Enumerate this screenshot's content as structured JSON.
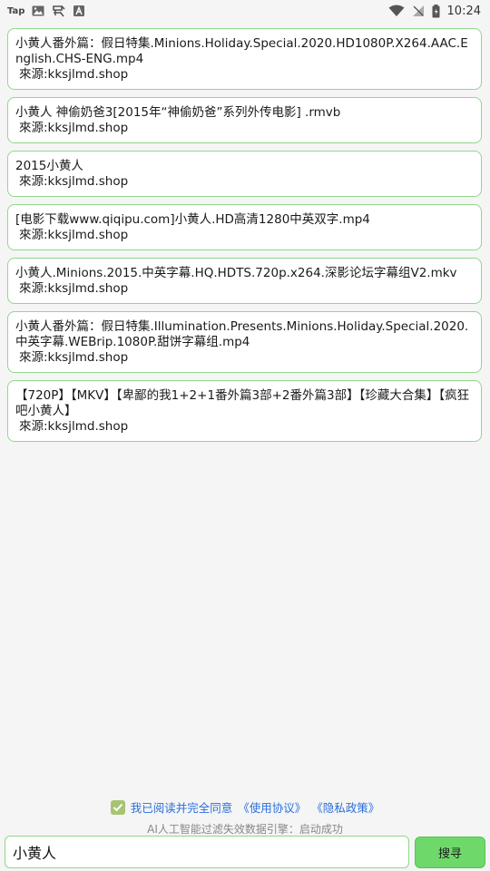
{
  "status_bar": {
    "left_icons": [
      "tap-icon",
      "image-icon",
      "kuaishou-icon",
      "font-icon"
    ],
    "tap_label": "Tap",
    "time": "10:24",
    "right_icons": [
      "wifi-icon",
      "no-signal-icon",
      "battery-icon"
    ]
  },
  "results": [
    {
      "title": "小黄人番外篇：假日特集.Minions.Holiday.Special.2020.HD1080P.X264.AAC.English.CHS-ENG.mp4",
      "source": "來源:kksjlmd.shop"
    },
    {
      "title": "小黄人 神偷奶爸3[2015年“神偷奶爸”系列外传电影] .rmvb",
      "source": "來源:kksjlmd.shop"
    },
    {
      "title": "2015小黄人",
      "source": "來源:kksjlmd.shop"
    },
    {
      "title": "[电影下载www.qiqipu.com]小黄人.HD高清1280中英双字.mp4",
      "source": "來源:kksjlmd.shop"
    },
    {
      "title": "小黄人.Minions.2015.中英字幕.HQ.HDTS.720p.x264.深影论坛字幕组V2.mkv",
      "source": "來源:kksjlmd.shop"
    },
    {
      "title": "小黄人番外篇：假日特集.Illumination.Presents.Minions.Holiday.Special.2020.中英字幕.WEBrip.1080P.甜饼字幕组.mp4",
      "source": "來源:kksjlmd.shop"
    },
    {
      "title": "【720P】【MKV】【卑鄙的我1+2+1番外篇3部+2番外篇3部】【珍藏大合集】【疯狂吧小黄人】",
      "source": "來源:kksjlmd.shop"
    }
  ],
  "agreement": {
    "checked": true,
    "text": "我已阅读并完全同意",
    "terms_link": "《使用协议》",
    "privacy_link": "《隐私政策》"
  },
  "engine_status": "AI人工智能过滤失效数据引擎：启动成功",
  "search": {
    "value": "小黄人",
    "button_label": "搜寻"
  },
  "colors": {
    "card_border": "#8fd88a",
    "button_bg": "#6fd86a",
    "link": "#2a6fdb",
    "checkbox": "#a6c472"
  }
}
